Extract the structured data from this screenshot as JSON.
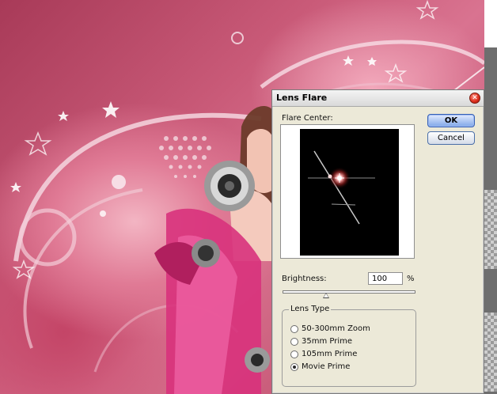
{
  "dialog": {
    "title": "Lens Flare",
    "close_icon": "close-icon",
    "flare_center_label": "Flare Center:",
    "ok_label": "OK",
    "cancel_label": "Cancel",
    "brightness": {
      "label": "Brightness:",
      "value": "100",
      "unit": "%",
      "slider_fraction": 0.33
    },
    "lens_type": {
      "group_label": "Lens Type",
      "options": [
        {
          "label": "50-300mm Zoom",
          "selected": false
        },
        {
          "label": "35mm Prime",
          "selected": false
        },
        {
          "label": "105mm Prime",
          "selected": false
        },
        {
          "label": "Movie Prime",
          "selected": true
        }
      ]
    }
  },
  "colors": {
    "accent_ok": "#7fa6e8",
    "dialog_bg": "#ece9d8",
    "artwork_pink": "#d9738f"
  }
}
